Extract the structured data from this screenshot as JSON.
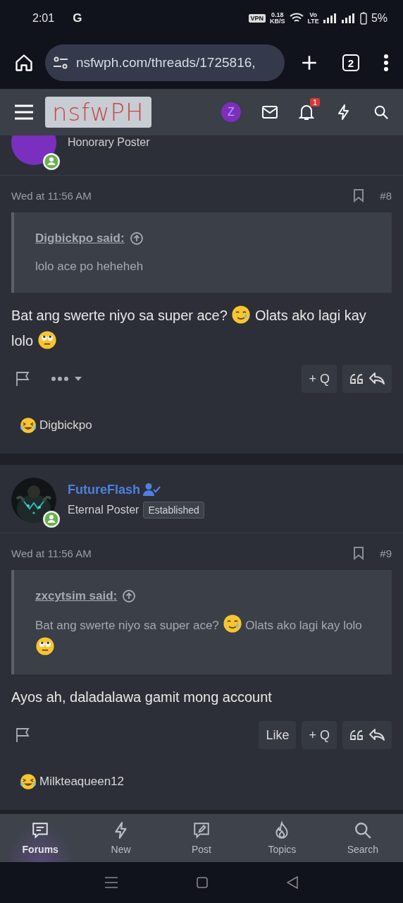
{
  "status_bar": {
    "time": "2:01",
    "g": "G",
    "vpn": "VPN",
    "speed": "0.18",
    "speed_unit": "KB/S",
    "volte_top": "Vo",
    "volte_bottom": "LTE",
    "battery": "5%"
  },
  "browser": {
    "url": "nsfwph.com/threads/1725816,",
    "tab_count": "2"
  },
  "header": {
    "logo": "nsfwPH",
    "avatar_letter": "Z",
    "notification_count": "1"
  },
  "posts": [
    {
      "author": {
        "avatar": {
          "kind": "plain"
        },
        "title": "Honorary Poster"
      },
      "date": "Wed at 11:56 AM",
      "number": "#8",
      "quote": {
        "author": "Digbickpo said:",
        "text": [
          {
            "kind": "text",
            "text": "lolo ace po heheheh"
          }
        ]
      },
      "body": [
        {
          "kind": "text",
          "text": "Bat ang swerte niyo sa super ace? "
        },
        {
          "kind": "smile"
        },
        {
          "kind": "text",
          "text": " Olats ako lagi kay lolo "
        },
        {
          "kind": "eyeroll"
        }
      ],
      "more_menu": true,
      "multiquote": "+ Q",
      "reaction": "Digbickpo"
    },
    {
      "author": {
        "name": "FutureFlash",
        "verified": true,
        "title": "Eternal Poster",
        "badge": "Established"
      },
      "date": "Wed at 11:56 AM",
      "number": "#9",
      "quote": {
        "author": "zxcytsim said:",
        "text": [
          {
            "kind": "text",
            "text": "Bat ang swerte niyo sa super ace? "
          },
          {
            "kind": "smile"
          },
          {
            "kind": "text",
            "text": " Olats ako lagi kay lolo "
          },
          {
            "kind": "eyeroll"
          }
        ]
      },
      "body": [
        {
          "kind": "text",
          "text": "Ayos ah, daladalawa gamit mong account"
        }
      ],
      "like": "Like",
      "multiquote": "+ Q",
      "reaction": "Milkteaqueen12"
    }
  ],
  "bottom_nav": [
    {
      "kind": "forums",
      "label": "Forums",
      "selected": true
    },
    {
      "kind": "new",
      "label": "New",
      "selected": false
    },
    {
      "kind": "post",
      "label": "Post",
      "selected": false
    },
    {
      "kind": "topics",
      "label": "Topics",
      "selected": false
    },
    {
      "kind": "search",
      "label": "Search",
      "selected": false
    }
  ]
}
